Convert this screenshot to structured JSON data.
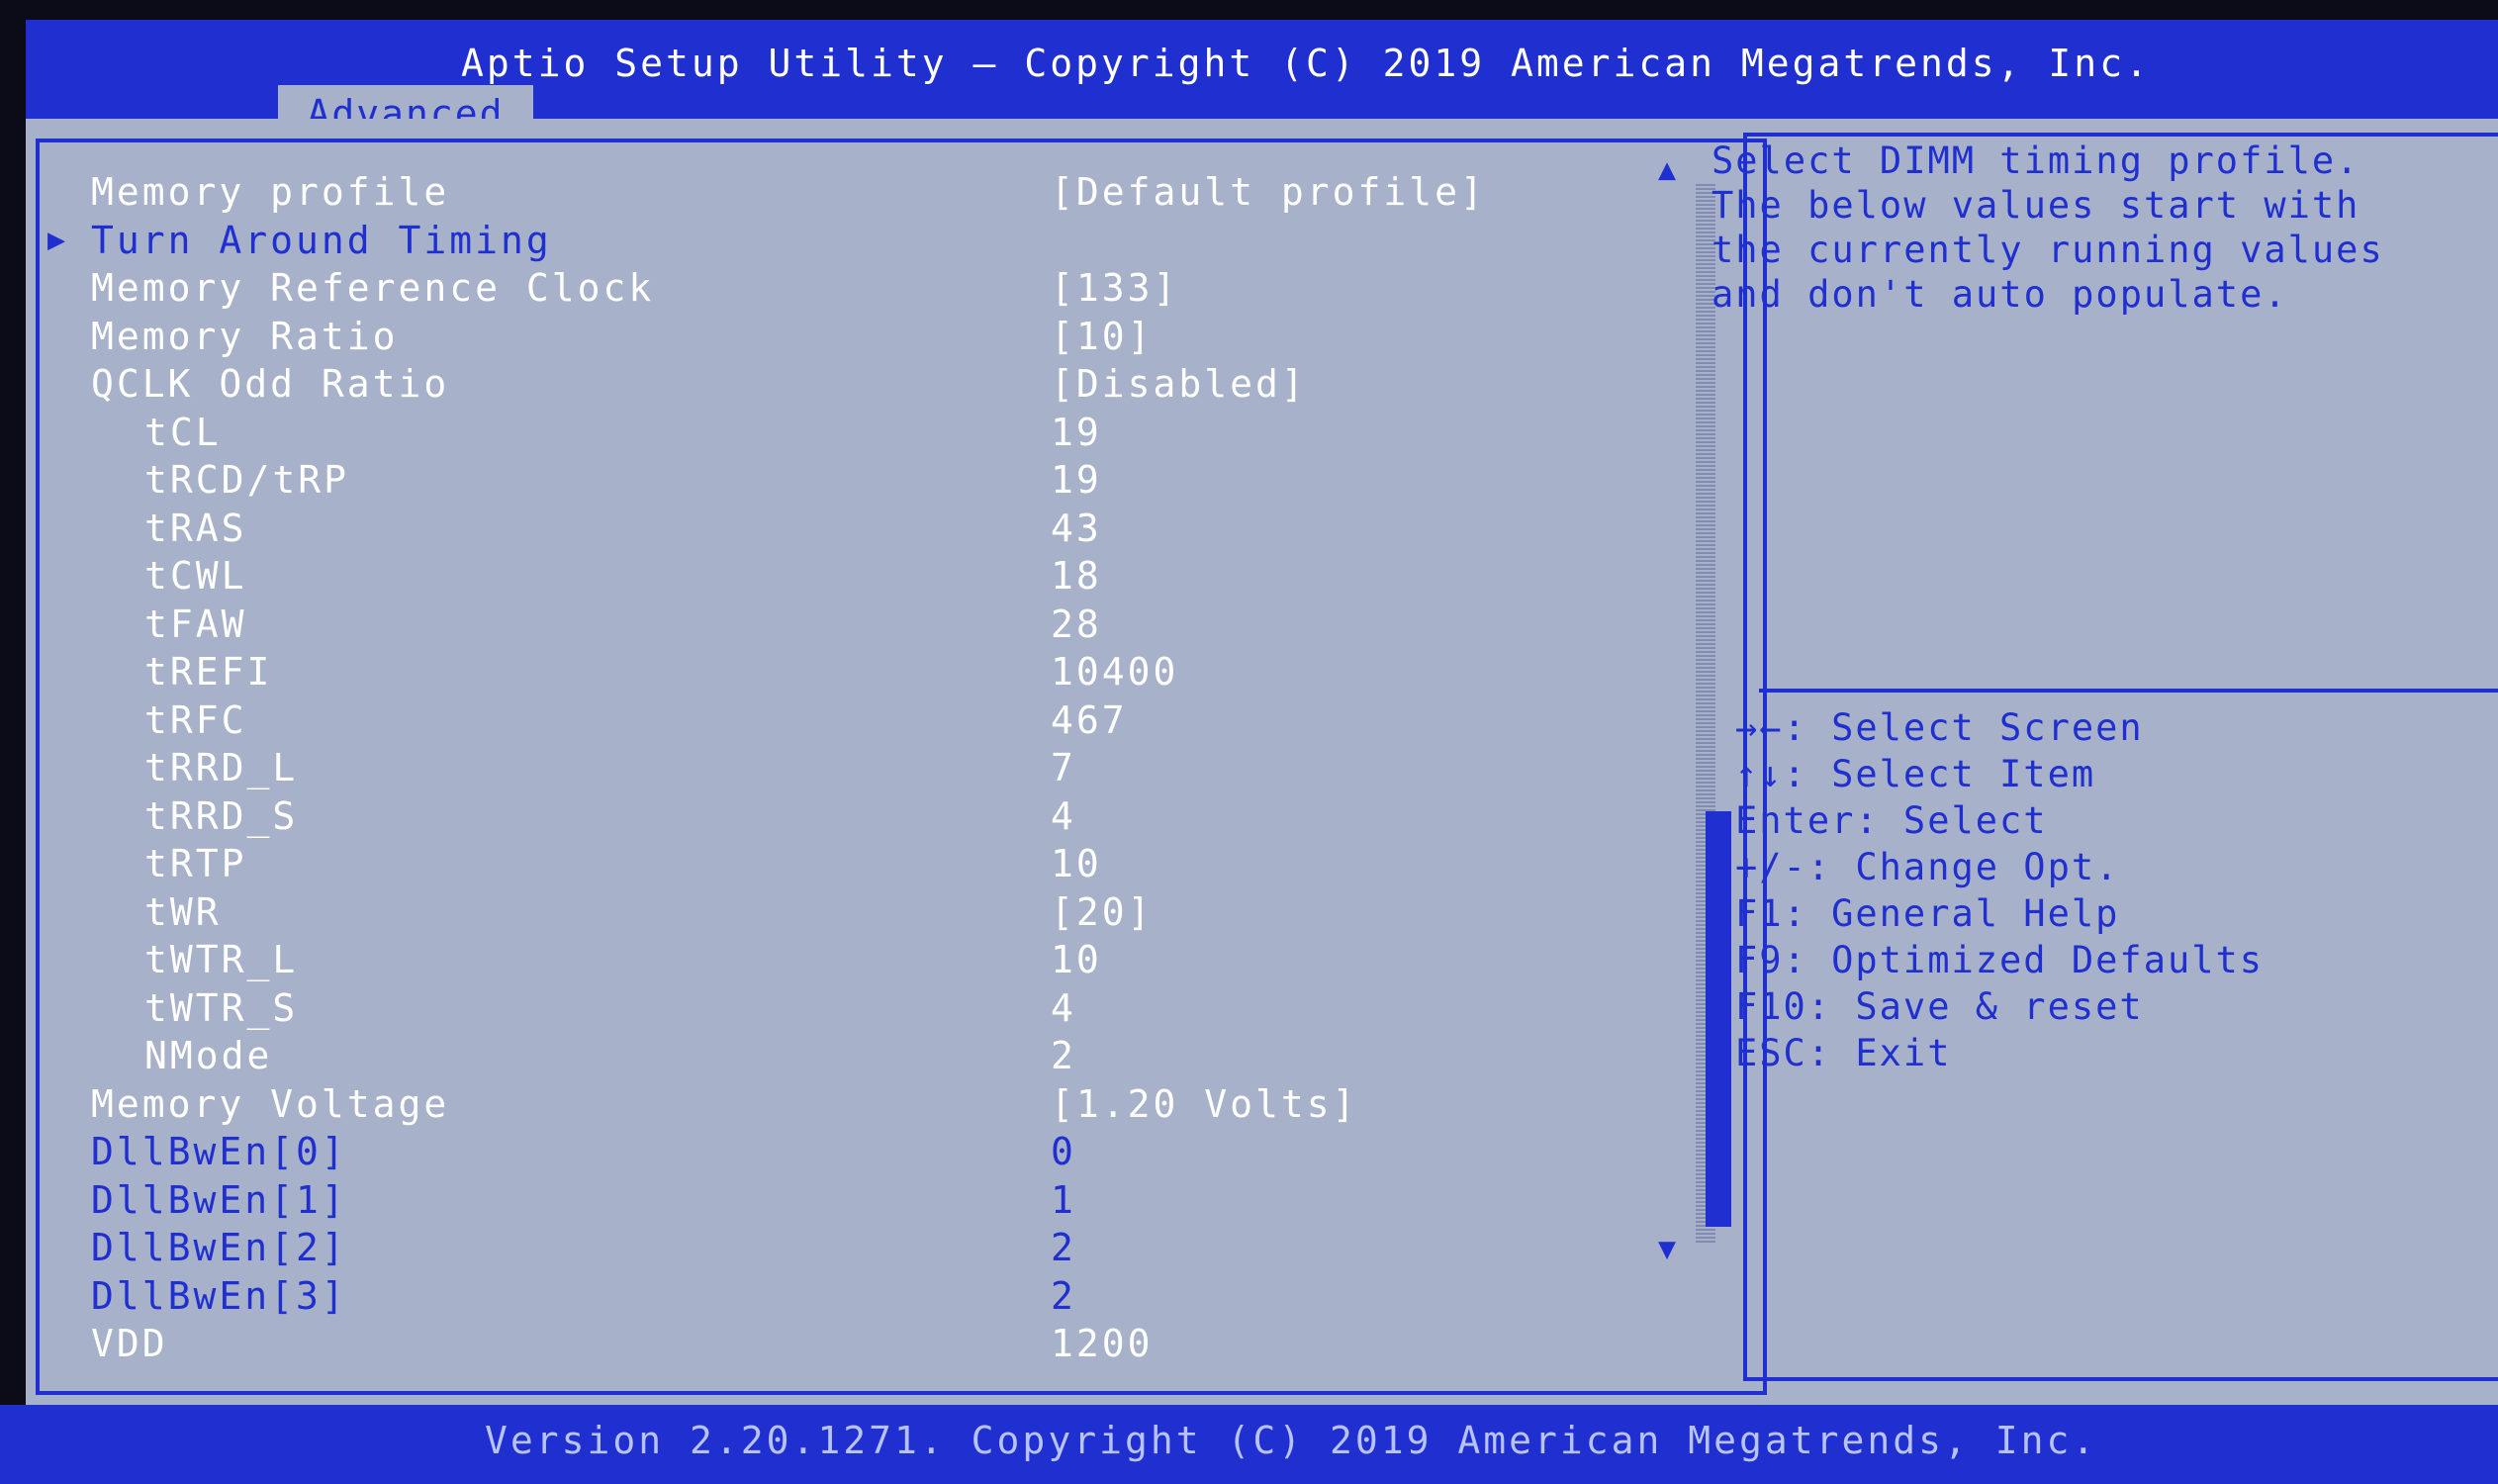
{
  "header": {
    "title": "Aptio Setup Utility – Copyright (C) 2019 American Megatrends, Inc.",
    "tabs": [
      {
        "label": "Advanced"
      }
    ]
  },
  "menu": {
    "items": [
      {
        "label": "Memory profile",
        "value": "[Default profile]",
        "style": "white",
        "indent": 0
      },
      {
        "label": "Turn Around Timing",
        "value": "",
        "style": "blue",
        "indent": 0,
        "submenu": true
      },
      {
        "label": "Memory Reference Clock",
        "value": "[133]",
        "style": "white",
        "indent": 0
      },
      {
        "label": "Memory Ratio",
        "value": "[10]",
        "style": "white",
        "indent": 0
      },
      {
        "label": "QCLK Odd Ratio",
        "value": "[Disabled]",
        "style": "white",
        "indent": 0
      },
      {
        "label": "tCL",
        "value": "19",
        "style": "white",
        "indent": 1
      },
      {
        "label": "tRCD/tRP",
        "value": "19",
        "style": "white",
        "indent": 1
      },
      {
        "label": "tRAS",
        "value": "43",
        "style": "white",
        "indent": 1
      },
      {
        "label": "tCWL",
        "value": "18",
        "style": "white",
        "indent": 1
      },
      {
        "label": "tFAW",
        "value": "28",
        "style": "white",
        "indent": 1
      },
      {
        "label": "tREFI",
        "value": "10400",
        "style": "white",
        "indent": 1
      },
      {
        "label": "tRFC",
        "value": "467",
        "style": "white",
        "indent": 1
      },
      {
        "label": "tRRD_L",
        "value": "7",
        "style": "white",
        "indent": 1
      },
      {
        "label": "tRRD_S",
        "value": "4",
        "style": "white",
        "indent": 1
      },
      {
        "label": "tRTP",
        "value": "10",
        "style": "white",
        "indent": 1
      },
      {
        "label": "tWR",
        "value": "[20]",
        "style": "white",
        "indent": 1
      },
      {
        "label": "tWTR_L",
        "value": "10",
        "style": "white",
        "indent": 1
      },
      {
        "label": "tWTR_S",
        "value": "4",
        "style": "white",
        "indent": 1
      },
      {
        "label": "NMode",
        "value": "2",
        "style": "white",
        "indent": 1
      },
      {
        "label": "Memory Voltage",
        "value": "[1.20 Volts]",
        "style": "white",
        "indent": 0
      },
      {
        "label": "DllBwEn[0]",
        "value": "0",
        "style": "blue",
        "indent": 0
      },
      {
        "label": "DllBwEn[1]",
        "value": "1",
        "style": "blue",
        "indent": 0
      },
      {
        "label": "DllBwEn[2]",
        "value": "2",
        "style": "blue",
        "indent": 0
      },
      {
        "label": "DllBwEn[3]",
        "value": "2",
        "style": "blue",
        "indent": 0
      },
      {
        "label": "VDD",
        "value": "1200",
        "style": "white",
        "indent": 0
      }
    ]
  },
  "help": {
    "lines": [
      "Select DIMM timing profile.",
      "The below values start with",
      "the currently running values",
      "and don't auto populate."
    ]
  },
  "keys": {
    "lines": [
      "→←: Select Screen",
      "↑↓: Select Item",
      "Enter: Select",
      "+/-: Change Opt.",
      "F1: General Help",
      "F9: Optimized Defaults",
      "F10: Save & reset",
      "ESC: Exit"
    ]
  },
  "icons": {
    "submenu": "triangle-right-icon",
    "scroll_up": "triangle-up-icon",
    "scroll_down": "triangle-down-icon"
  },
  "footer": {
    "text": "Version 2.20.1271. Copyright (C) 2019 American Megatrends, Inc."
  },
  "colors": {
    "accent": "#1f2fd0",
    "panel": "#a7b1c9",
    "text_white": "#ffffff"
  }
}
